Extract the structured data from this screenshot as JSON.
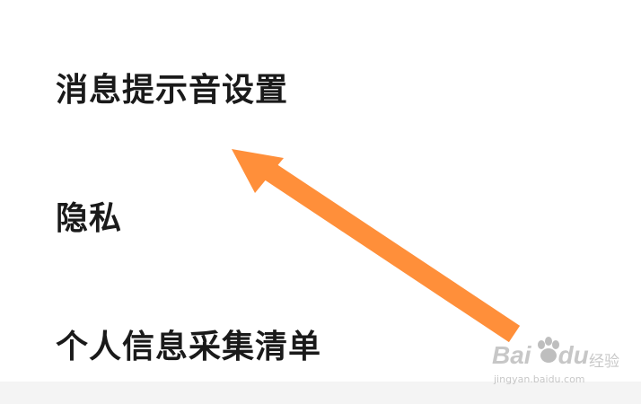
{
  "settings": {
    "items": [
      {
        "label": "消息提示音设置"
      },
      {
        "label": "隐私"
      },
      {
        "label": "个人信息采集清单"
      }
    ]
  },
  "annotation": {
    "arrow_color": "#ff8f3a",
    "points_to": "消息提示音设置"
  },
  "watermark": {
    "brand": "Bai",
    "brand_suffix": "du",
    "label": "经验",
    "url": "jingyan.baidu.com"
  }
}
